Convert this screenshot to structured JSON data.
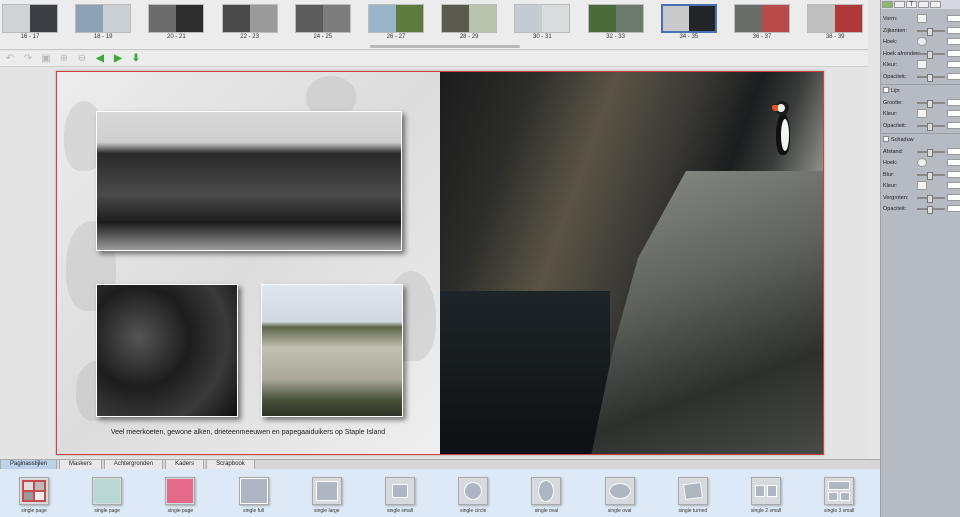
{
  "thumbnails": [
    {
      "label": "16 - 17",
      "left": "#cfd3d6",
      "right": "#3b3f44",
      "selected": false
    },
    {
      "label": "18 - 19",
      "left": "#8ea2b6",
      "right": "#c9cfd3",
      "selected": false
    },
    {
      "label": "20 - 21",
      "left": "#6b6b6b",
      "right": "#2d2d2d",
      "selected": false
    },
    {
      "label": "22 - 23",
      "left": "#4a4a4a",
      "right": "#9a9a9a",
      "selected": false
    },
    {
      "label": "24 - 25",
      "left": "#5c5c5c",
      "right": "#7c7c7c",
      "selected": false
    },
    {
      "label": "26 - 27",
      "left": "#9ab4c9",
      "right": "#5f7a3f",
      "selected": false
    },
    {
      "label": "28 - 29",
      "left": "#5a5a4e",
      "right": "#b8c2ac",
      "selected": false
    },
    {
      "label": "30 - 31",
      "left": "#c2ccd2",
      "right": "#d9dcdc",
      "selected": false
    },
    {
      "label": "32 - 33",
      "left": "#4a6a3a",
      "right": "#6b7a6a",
      "selected": false
    },
    {
      "label": "34 - 35",
      "left": "#c9c9c9",
      "right": "#232526",
      "selected": true
    },
    {
      "label": "36 - 37",
      "left": "#6a6e6a",
      "right": "#b84a4a",
      "selected": false
    },
    {
      "label": "38 - 39",
      "left": "#c0c0c0",
      "right": "#b03a3a",
      "selected": false
    }
  ],
  "toolbar": {
    "undo_icon": "undo-icon",
    "redo_icon": "redo-icon",
    "save_icon": "save-icon",
    "zoom_in_icon": "zoom-in-icon",
    "zoom_out_icon": "zoom-out-icon",
    "back_icon": "arrow-left-icon",
    "forward_icon": "arrow-right-icon",
    "download_icon": "download-icon"
  },
  "spread": {
    "caption": "Veel meerkoeten, gewone alken, drieteenmeeuwen en papegaaiduikers op Staple Island"
  },
  "inspector": {
    "rows_main": [
      {
        "label": "Vorm:",
        "control": "box"
      },
      {
        "label": "Zijkanten:",
        "control": "slider"
      },
      {
        "label": "Hoek:",
        "control": "knob"
      },
      {
        "label": "Hoek afronden:",
        "control": "slider"
      },
      {
        "label": "Kleur:",
        "control": "box"
      },
      {
        "label": "Opaciteit:",
        "control": "slider"
      }
    ],
    "section_line": "Lijn",
    "rows_line": [
      {
        "label": "Grootte:",
        "control": "slider"
      },
      {
        "label": "Kleur:",
        "control": "box"
      },
      {
        "label": "Opaciteit:",
        "control": "slider"
      }
    ],
    "section_shadow": "Schaduw",
    "rows_shadow": [
      {
        "label": "Afstand:",
        "control": "slider"
      },
      {
        "label": "Hoek:",
        "control": "knob"
      },
      {
        "label": "Blur:",
        "control": "slider"
      },
      {
        "label": "Kleur:",
        "control": "box"
      },
      {
        "label": "Vergroten:",
        "control": "slider"
      },
      {
        "label": "Opaciteit:",
        "control": "slider"
      }
    ]
  },
  "bottom_tabs": [
    {
      "label": "Paginasstijlen",
      "active": true
    },
    {
      "label": "Maskers",
      "active": false
    },
    {
      "label": "Achtergronden",
      "active": false
    },
    {
      "label": "Kaders",
      "active": false
    },
    {
      "label": "Scrapbook",
      "active": false
    }
  ],
  "layouts": [
    {
      "label": "single page",
      "kind": "collage"
    },
    {
      "label": "single page",
      "kind": "puffin"
    },
    {
      "label": "single page",
      "kind": "pink"
    },
    {
      "label": "single full",
      "kind": "full"
    },
    {
      "label": "single large",
      "kind": "large"
    },
    {
      "label": "single small",
      "kind": "small"
    },
    {
      "label": "single circle",
      "kind": "circle"
    },
    {
      "label": "single oval",
      "kind": "oval-v"
    },
    {
      "label": "single oval",
      "kind": "oval-h"
    },
    {
      "label": "single turned",
      "kind": "turned"
    },
    {
      "label": "single 2 small",
      "kind": "two"
    },
    {
      "label": "single 3 small",
      "kind": "three"
    }
  ],
  "colors": {
    "accent": "#4a6fb5",
    "guide": "#d04040",
    "panel": "#b5bac3",
    "layout_strip": "#dde9f6"
  }
}
